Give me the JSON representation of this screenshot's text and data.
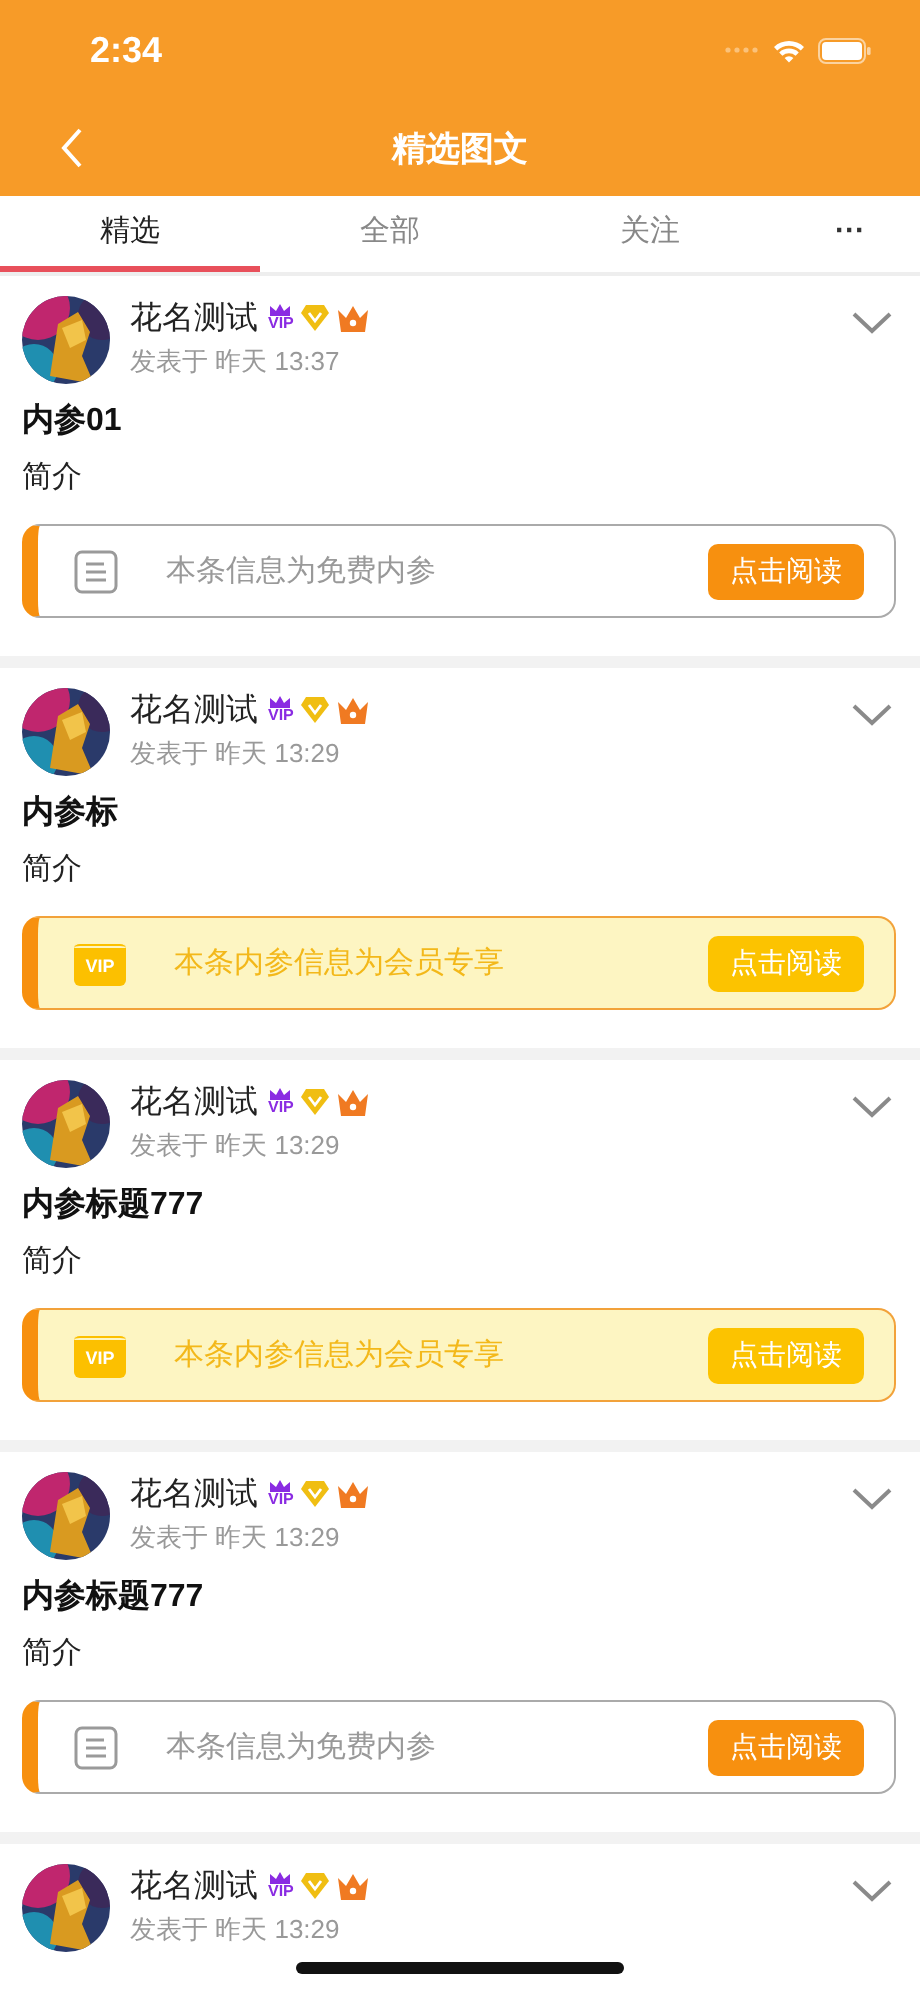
{
  "status_bar": {
    "time": "2:34"
  },
  "nav": {
    "title": "精选图文"
  },
  "tabs": [
    {
      "label": "精选",
      "selected": true
    },
    {
      "label": "全部",
      "selected": false
    },
    {
      "label": "关注",
      "selected": false
    },
    {
      "label": "···",
      "selected": false
    }
  ],
  "posts": [
    {
      "author": "花名测试",
      "vip_badge": "VIP",
      "posted": "发表于 昨天 13:37",
      "title": "内参01",
      "intro": "简介",
      "card": {
        "kind": "free",
        "message": "本条信息为免费内参",
        "button": "点击阅读"
      }
    },
    {
      "author": "花名测试",
      "vip_badge": "VIP",
      "posted": "发表于 昨天 13:29",
      "title": "内参标",
      "intro": "简介",
      "card": {
        "kind": "vip",
        "icon_text": "VIP",
        "message": "本条内参信息为会员专享",
        "button": "点击阅读"
      }
    },
    {
      "author": "花名测试",
      "vip_badge": "VIP",
      "posted": "发表于 昨天 13:29",
      "title": "内参标题777",
      "intro": "简介",
      "card": {
        "kind": "vip",
        "icon_text": "VIP",
        "message": "本条内参信息为会员专享",
        "button": "点击阅读"
      }
    },
    {
      "author": "花名测试",
      "vip_badge": "VIP",
      "posted": "发表于 昨天 13:29",
      "title": "内参标题777",
      "intro": "简介",
      "card": {
        "kind": "free",
        "message": "本条信息为免费内参",
        "button": "点击阅读"
      }
    },
    {
      "author": "花名测试",
      "vip_badge": "VIP",
      "posted": "发表于 昨天 13:29"
    }
  ]
}
